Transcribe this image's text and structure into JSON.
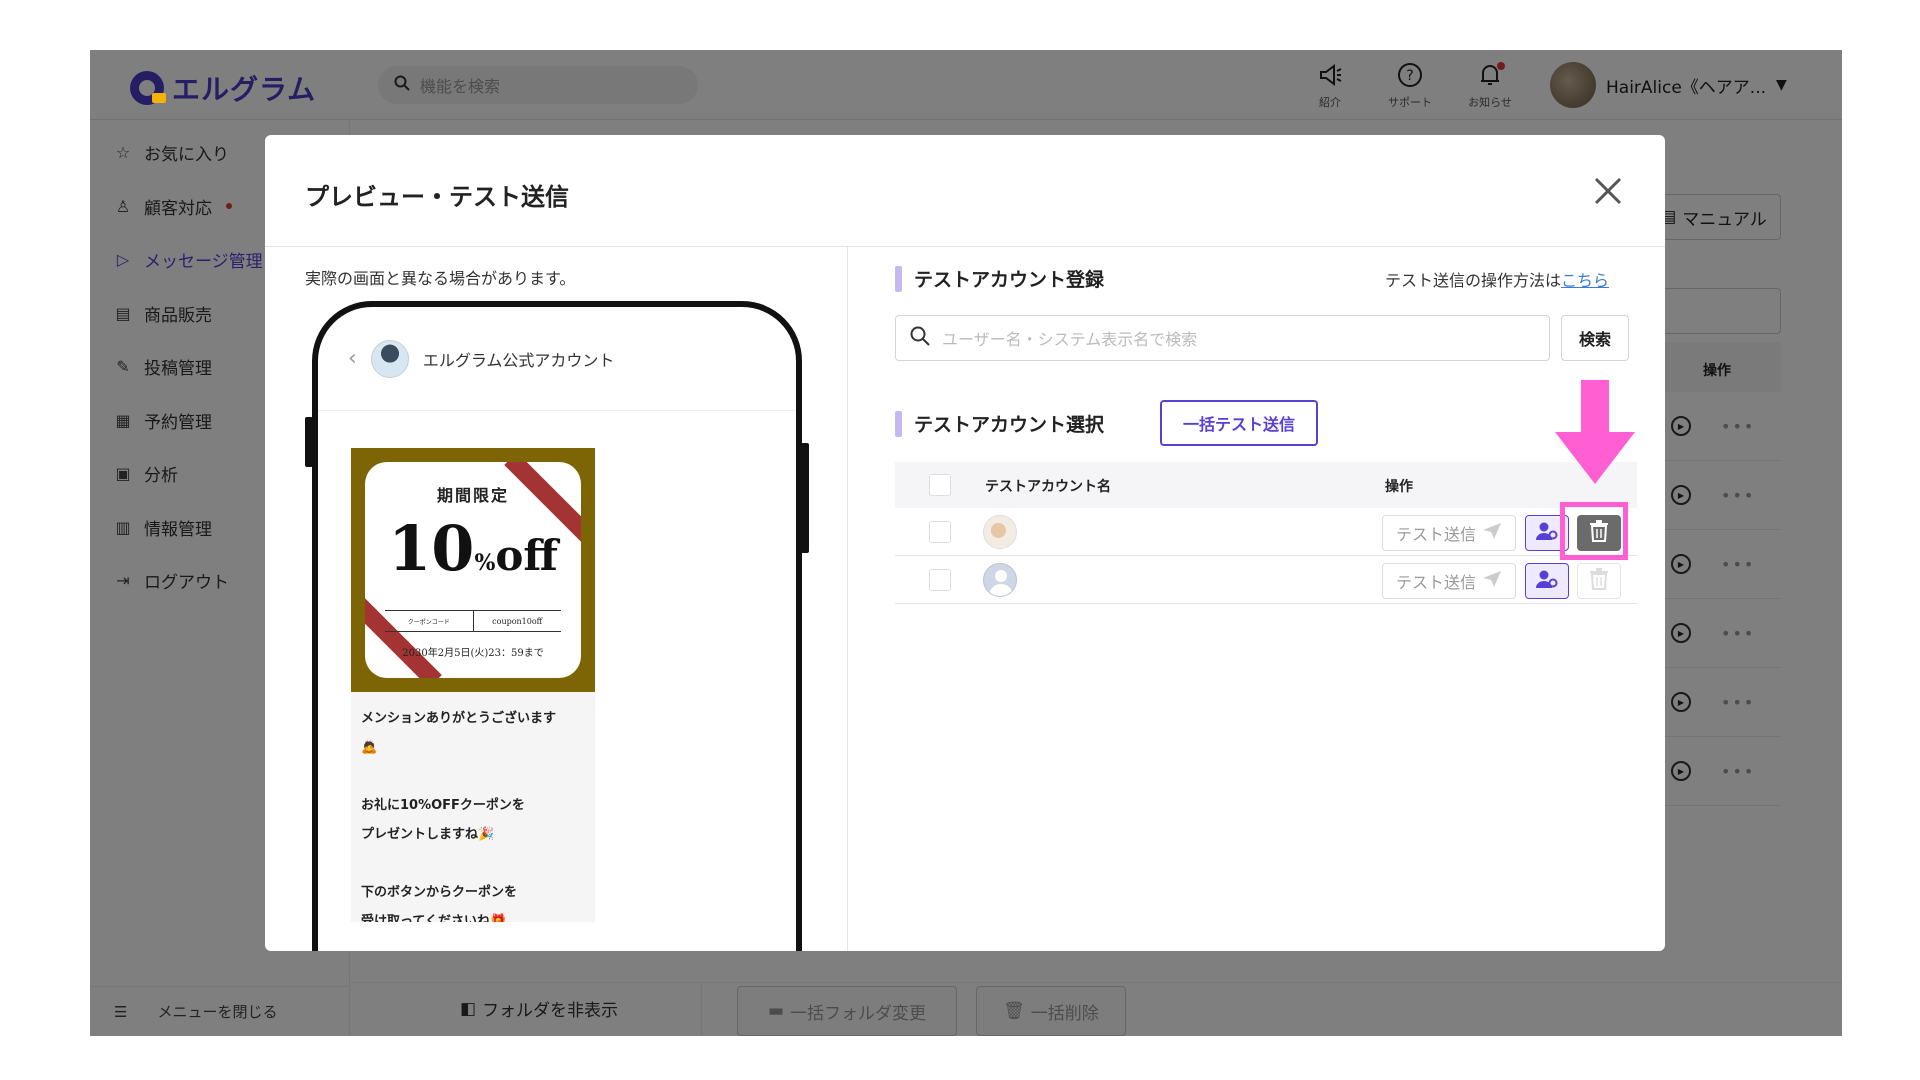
{
  "app": {
    "logo_text": "エルグラム",
    "search_placeholder": "機能を検索",
    "top_icons": [
      {
        "icon": "megaphone-icon",
        "label": "紹介"
      },
      {
        "icon": "help-circle-icon",
        "label": "サポート"
      },
      {
        "icon": "bell-icon",
        "label": "お知らせ"
      }
    ],
    "user_name": "HairAlice《ヘアア...",
    "accent_color": "#5a3fd6"
  },
  "sidebar": {
    "items": [
      {
        "icon": "star-icon",
        "label": "お気に入り"
      },
      {
        "icon": "person-icon",
        "label": "顧客対応"
      },
      {
        "icon": "send-icon",
        "label": "メッセージ管理"
      },
      {
        "icon": "store-icon",
        "label": "商品販売"
      },
      {
        "icon": "edit-icon",
        "label": "投稿管理"
      },
      {
        "icon": "calendar-icon",
        "label": "予約管理"
      },
      {
        "icon": "analytics-icon",
        "label": "分析"
      },
      {
        "icon": "chart-icon",
        "label": "情報管理"
      },
      {
        "icon": "logout-icon",
        "label": "ログアウト"
      }
    ],
    "close_menu_label": "メニューを閉じる"
  },
  "background": {
    "manual_label": "マニュアル",
    "op_header": "操作",
    "folder_toggle_label": "フォルダを非表示",
    "bulk_folder_label": "一括フォルダ変更",
    "bulk_delete_label": "一括削除"
  },
  "modal": {
    "title": "プレビュー・テスト送信",
    "preview_note": "実際の画面と異なる場合があります。",
    "chat": {
      "account_name": "エルグラム公式アカウント",
      "coupon": {
        "title": "期間限定",
        "number": "10",
        "percent": "%",
        "off": "off",
        "code_label": "クーポンコード",
        "code_value": "coupon10off",
        "deadline": "2030年2月5日(火)23：59まで"
      },
      "message_lines": [
        "メンションありがとうございます",
        "🙇",
        "",
        "お礼に10%OFFクーポンを",
        "プレゼントしますね🎉",
        "",
        "下のボタンからクーポンを",
        "受け取ってくださいね🎁"
      ]
    },
    "register_section_title": "テストアカウント登録",
    "howto_text": "テスト送信の操作方法は",
    "howto_link": "こちら",
    "account_search_placeholder": "ユーザー名・システム表示名で検索",
    "search_button": "検索",
    "select_section_title": "テストアカウント選択",
    "bulk_send_button": "一括テスト送信",
    "table": {
      "col_name": "テストアカウント名",
      "col_op": "操作",
      "rows": [
        {
          "name": "",
          "test_send_label": "テスト送信",
          "delete_enabled": true
        },
        {
          "name": "",
          "test_send_label": "テスト送信",
          "delete_enabled": false
        }
      ]
    },
    "annotation_color": "#ff5fd3"
  }
}
